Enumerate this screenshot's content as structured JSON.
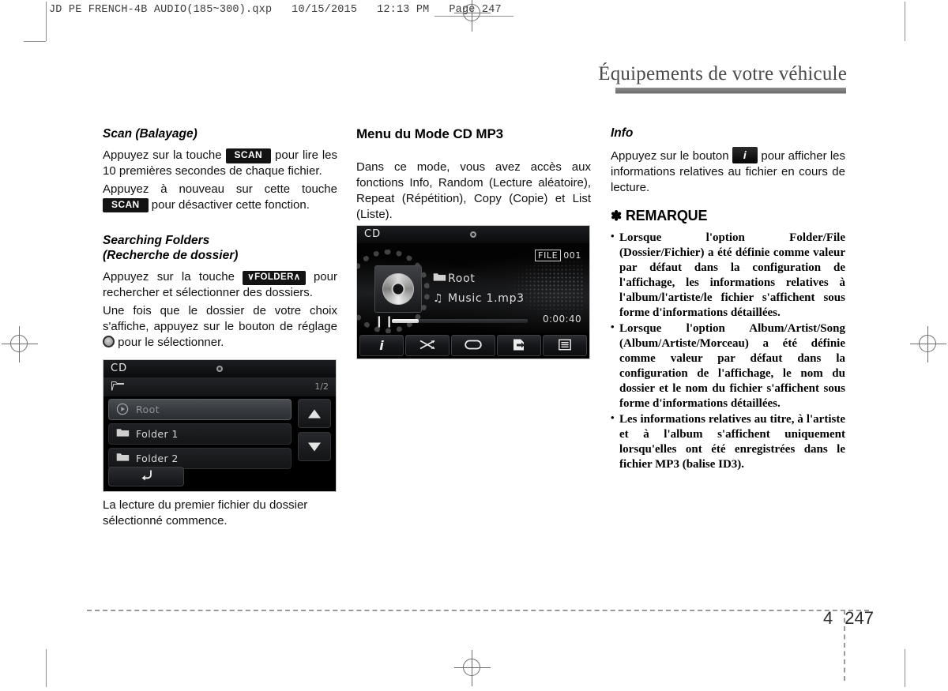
{
  "prepress": {
    "header_line": "JD PE FRENCH-4B AUDIO(185~300).qxp   10/15/2015   12:13 PM   Page 247"
  },
  "running_head": {
    "title": "Équipements de votre véhicule"
  },
  "footer": {
    "chapter": "4",
    "page": "247"
  },
  "column_left": {
    "scan": {
      "heading": "Scan (Balayage)",
      "p1_before": "Appuyez sur la touche",
      "p1_key": "SCAN",
      "p1_after": "pour lire les 10 premières secondes de chaque fichier.",
      "p2_before": "Appuyez à nouveau sur cette touche",
      "p2_key": "SCAN",
      "p2_after": "pour désactiver cette fonction."
    },
    "searching_folders": {
      "heading_line1": "Searching Folders",
      "heading_line2": "(Recherche de dossier)",
      "p1_before": "Appuyez sur la touche",
      "p1_key": "∨FOLDER∧",
      "p1_after": "pour rechercher et sélectionner des dossiers.",
      "p2_before": "Une fois que le dossier de votre choix s'affiche, appuyez sur le bouton de réglage",
      "p2_knob": "setting-knob-icon",
      "p2_after": "pour le sélectionner."
    },
    "caption": "La lecture du premier fichier du dossier sélectionné commence."
  },
  "column_middle": {
    "heading": "Menu du Mode CD MP3",
    "paragraph": "Dans ce mode, vous avez accès aux fonctions Info, Random (Lecture aléatoire), Repeat (Répétition), Copy (Copie) et List (Liste)."
  },
  "column_right": {
    "info": {
      "heading": "Info",
      "p_before": "Appuyez sur le bouton",
      "p_key": "i",
      "p_after": "pour afficher les informations relatives au fichier en cours de lecture."
    },
    "remarque": {
      "star": "✽",
      "title": "REMARQUE",
      "bullets": [
        "Lorsque l'option Folder/File (Dossier/Fichier) a été définie comme valeur par défaut dans la configuration de l'affichage, les informations relatives à l'album/l'artiste/le fichier s'affichent sous forme d'informations détaillées.",
        "Lorsque l'option Album/Artist/Song (Album/Artiste/Morceau) a été définie comme valeur par défaut dans la configuration de l'affichage, le nom du dossier et le nom du fichier s'affichent sous forme d'informations détaillées.",
        "Les informations relatives au titre, à l'artiste et à l'album s'affichent uniquement lorsqu'elles ont été enregistrées dans le fichier MP3 (balise ID3)."
      ]
    }
  },
  "screen_folder_list": {
    "title": "CD",
    "page_indicator": "1/2",
    "folder_icon": "📂",
    "rows": [
      {
        "icon": "▶",
        "label": "Root",
        "selected": true
      },
      {
        "icon": "📁",
        "label": "Folder 1",
        "selected": false
      },
      {
        "icon": "📁",
        "label": "Folder 2",
        "selected": false
      }
    ],
    "scroll_up": "scroll-up-arrow",
    "scroll_down": "scroll-down-arrow",
    "back_glyph": "↰"
  },
  "screen_cd_player": {
    "title": "CD",
    "file_badge_label": "FILE",
    "file_number": "001",
    "folder_icon": "📁",
    "folder_name": "Root",
    "track_icon": "♫",
    "track_name": "Music 1.mp3",
    "pause_glyph": "❙❙",
    "elapsed_time": "0:00:40",
    "progress_percent": 20,
    "buttons": [
      {
        "name": "info-button",
        "glyph": "i"
      },
      {
        "name": "random-button",
        "glyph": "⤬"
      },
      {
        "name": "repeat-button",
        "glyph": "▭"
      },
      {
        "name": "copy-button",
        "glyph": "❏"
      },
      {
        "name": "list-button",
        "glyph": "▤"
      }
    ]
  }
}
